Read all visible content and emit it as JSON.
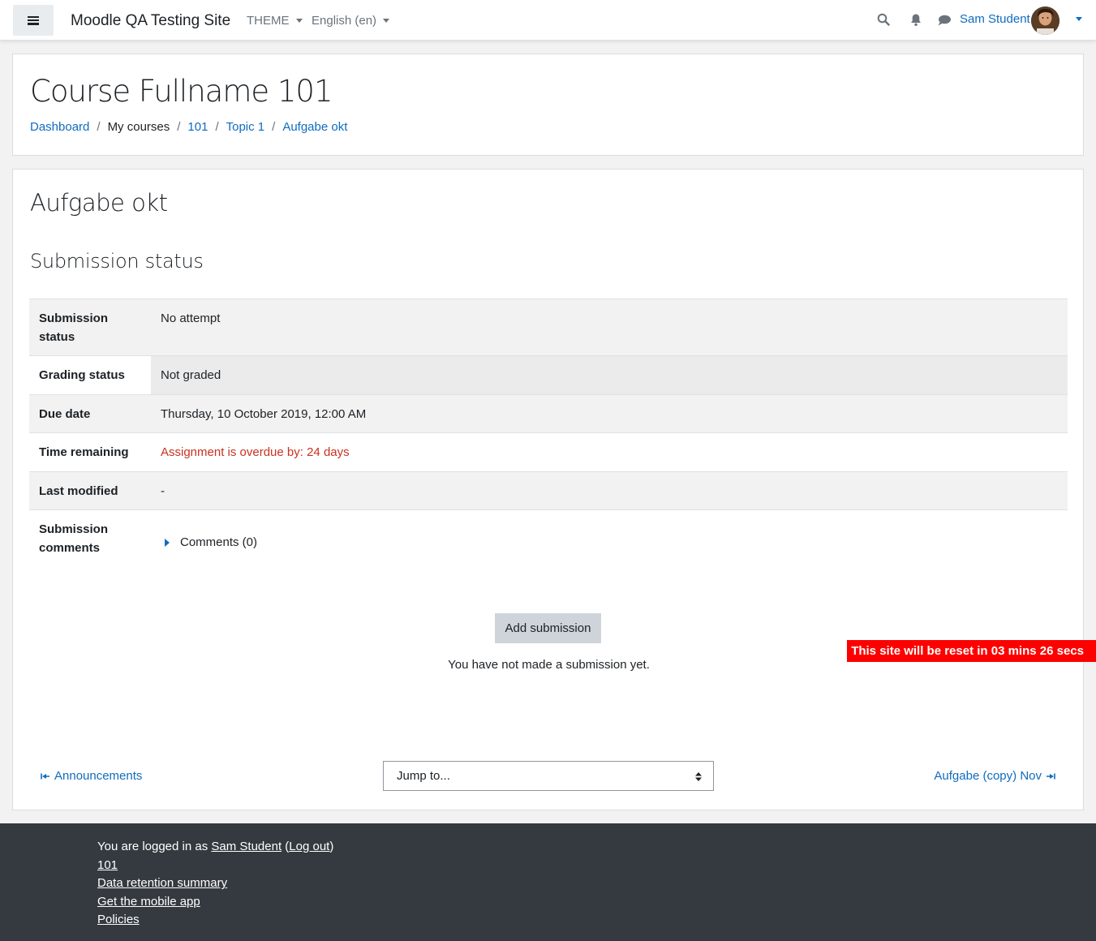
{
  "navbar": {
    "site_name": "Moodle QA Testing Site",
    "theme_menu": "THEME",
    "language_menu": "English (en)",
    "user_name": "Sam Student"
  },
  "header": {
    "course_title": "Course Fullname 101",
    "breadcrumb": [
      "Dashboard",
      "My courses",
      "101",
      "Topic 1",
      "Aufgabe okt"
    ]
  },
  "main": {
    "activity_title": "Aufgabe okt",
    "section_title": "Submission status",
    "rows": [
      {
        "label_line1": "Submission",
        "label_line2": "status",
        "value": "No attempt"
      },
      {
        "label": "Grading status",
        "value": "Not graded"
      },
      {
        "label": "Due date",
        "value": "Thursday, 10 October 2019, 12:00 AM"
      },
      {
        "label": "Time remaining",
        "value": "Assignment is overdue by: 24 days"
      },
      {
        "label": "Last modified",
        "value": "-"
      },
      {
        "label_line1": "Submission",
        "label_line2": "comments",
        "value": "Comments (0)"
      }
    ],
    "add_submission_label": "Add submission",
    "no_submission_text": "You have not made a submission yet.",
    "prev_activity": "Announcements",
    "next_activity": "Aufgabe (copy) Nov",
    "jump_to": "Jump to..."
  },
  "reset_banner": "This site will be reset in 03 mins 26 secs",
  "footer": {
    "logged_in_prefix": "You are logged in as",
    "user_name": "Sam Student",
    "logout": "Log out",
    "course_link": "101",
    "data_retention": "Data retention summary",
    "mobile_app": "Get the mobile app",
    "policies": "Policies"
  },
  "colors": {
    "link": "#0f6cbf",
    "overdue": "#ca3120",
    "banner": "#ff0000",
    "footer_bg": "#343a40"
  }
}
